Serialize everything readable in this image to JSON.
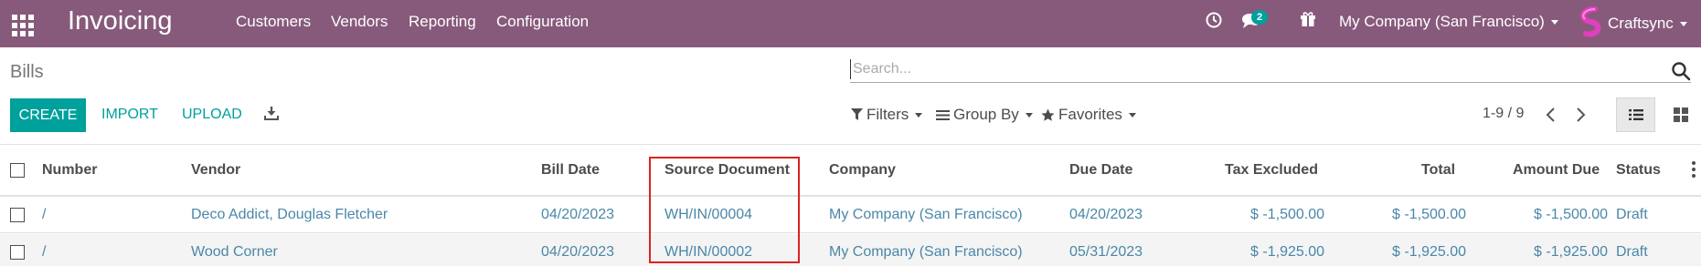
{
  "navbar": {
    "brand": "Invoicing",
    "menu": [
      "Customers",
      "Vendors",
      "Reporting",
      "Configuration"
    ],
    "message_count": "2",
    "company": "My Company (San Francisco)",
    "user": "Craftsync",
    "color": "#875a7b"
  },
  "control": {
    "breadcrumb": "Bills",
    "search_placeholder": "Search...",
    "create": "CREATE",
    "import": "IMPORT",
    "upload": "UPLOAD",
    "filters": "Filters",
    "group_by": "Group By",
    "favorites": "Favorites",
    "pager": "1-9 / 9",
    "accent": "#00a09d"
  },
  "table": {
    "columns": [
      "Number",
      "Vendor",
      "Bill Date",
      "Source Document",
      "Company",
      "Due Date",
      "Tax Excluded",
      "Total",
      "Amount Due",
      "Status"
    ],
    "rows": [
      {
        "number": "/",
        "vendor": "Deco Addict, Douglas Fletcher",
        "bill_date": "04/20/2023",
        "source": "WH/IN/00004",
        "company": "My Company (San Francisco)",
        "due_date": "04/20/2023",
        "tax_excluded": "$ -1,500.00",
        "total": "$ -1,500.00",
        "amount_due": "$ -1,500.00",
        "status": "Draft"
      },
      {
        "number": "/",
        "vendor": "Wood Corner",
        "bill_date": "04/20/2023",
        "source": "WH/IN/00002",
        "company": "My Company (San Francisco)",
        "due_date": "05/31/2023",
        "tax_excluded": "$ -1,925.00",
        "total": "$ -1,925.00",
        "amount_due": "$ -1,925.00",
        "status": "Draft"
      }
    ]
  },
  "icons": [
    "apps-grid-icon",
    "clock-icon",
    "chat-icon",
    "gift-icon",
    "user-avatar-icon",
    "search-icon",
    "download-icon",
    "filter-icon",
    "group-by-icon",
    "star-icon",
    "chevron-left-icon",
    "chevron-right-icon",
    "list-view-icon",
    "kanban-view-icon",
    "kebab-icon"
  ]
}
